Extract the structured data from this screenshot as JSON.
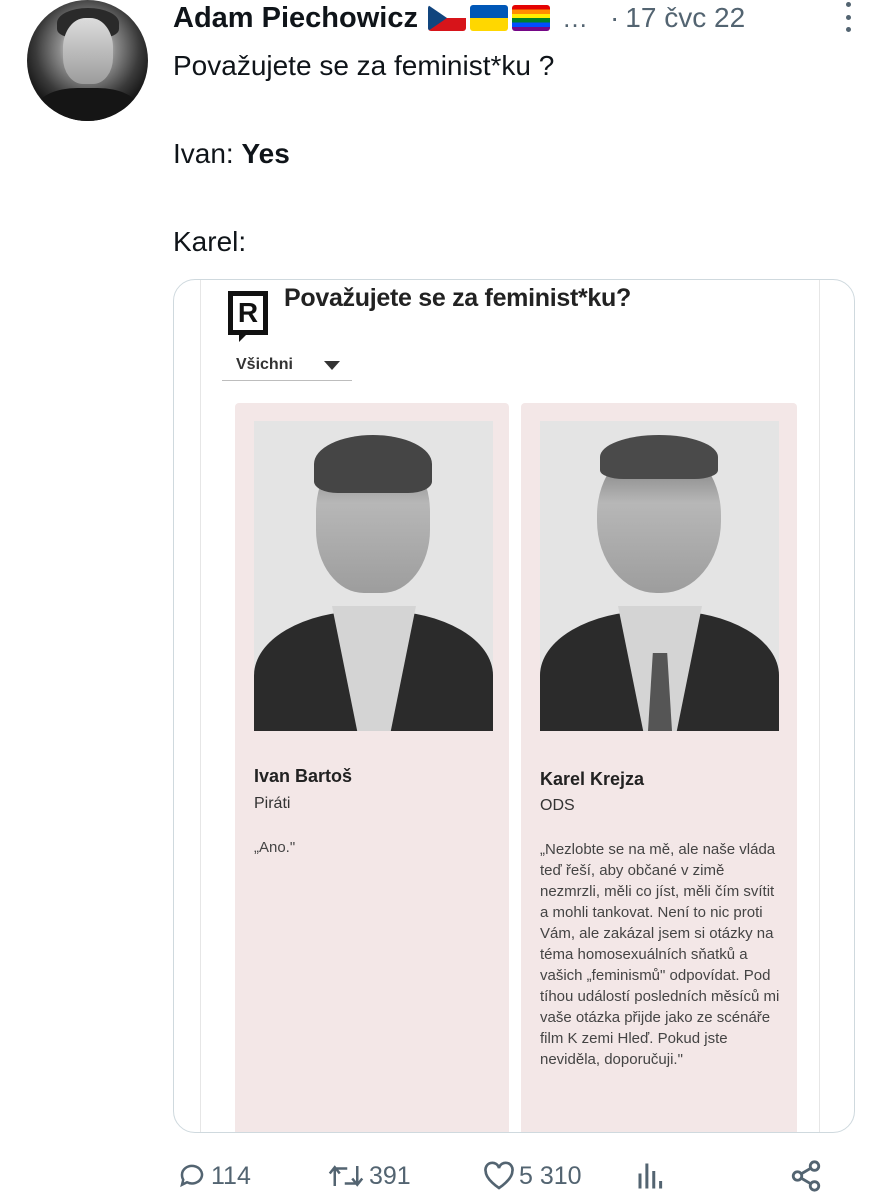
{
  "tweet": {
    "author": "Adam Piechowicz",
    "name_ellipsis": "…",
    "dot": "·",
    "time": "17 čvc 22",
    "lines": {
      "l1": "Považujete se za feminist*ku ?",
      "l2_prefix": "Ivan: ",
      "l2_bold": "Yes",
      "l3": "Karel:"
    }
  },
  "media": {
    "logo_letter": "R",
    "question": "Považujete se za feminist*ku?",
    "filter": "Všichni",
    "cards": [
      {
        "name": "Ivan Bartoš",
        "party": "Piráti",
        "quote": "„Ano.\""
      },
      {
        "name": "Karel Krejza",
        "party": "ODS",
        "quote": "„Nezlobte se na mě, ale naše vláda teď řeší, aby občané v zimě nezmrzli, měli co jíst, měli čím svítit a mohli tankovat. Není to nic proti Vám, ale zakázal jsem si otázky na téma homosexuálních sňatků a vašich „feminismů\" odpovídat. Pod tíhou událostí posledních měsíců mi vaše otázka přijde jako ze scénáře film K zemi Hleď. Pokud jste neviděla, doporučuji.\""
      }
    ]
  },
  "actions": {
    "replies": "114",
    "retweets": "391",
    "likes": "5 310"
  },
  "icons": {
    "reply": "reply-icon",
    "retweet": "retweet-icon",
    "like": "heart-icon",
    "views": "analytics-icon",
    "share": "share-icon",
    "more": "more-icon"
  },
  "colors": {
    "text": "#0f1419",
    "muted": "#536471",
    "card_bg": "#f3e7e7",
    "border": "#cfd9de"
  }
}
